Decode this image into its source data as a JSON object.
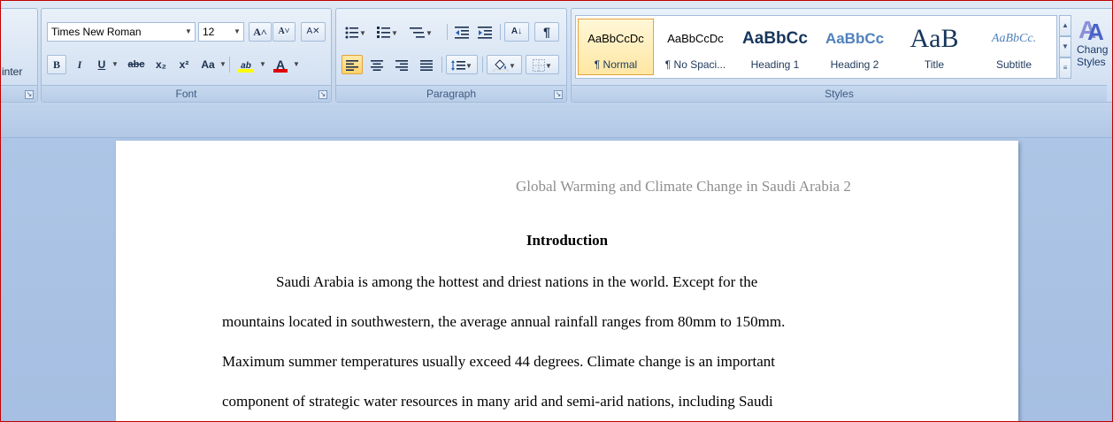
{
  "ribbon": {
    "clipboard": {
      "format_painter_label": "inter"
    },
    "font": {
      "group_label": "Font",
      "font_name": "Times New Roman",
      "font_size": "12",
      "grow_font": "A˄",
      "shrink_font": "A˅",
      "clear_format": "A✕",
      "bold": "B",
      "italic": "I",
      "underline": "U",
      "strikethrough": "abc",
      "subscript": "x₂",
      "superscript": "x²",
      "change_case": "Aa",
      "highlight": "ab",
      "font_color": "A"
    },
    "paragraph": {
      "group_label": "Paragraph",
      "sort": "A↓",
      "show_marks": "¶"
    },
    "styles": {
      "group_label": "Styles",
      "items": [
        {
          "sample": "AaBbCcDc",
          "name": "¶ Normal"
        },
        {
          "sample": "AaBbCcDc",
          "name": "¶ No Spaci..."
        },
        {
          "sample": "AaBbCc",
          "name": "Heading 1"
        },
        {
          "sample": "AaBbCc",
          "name": "Heading 2"
        },
        {
          "sample": "AaB",
          "name": "Title"
        },
        {
          "sample": "AaBbCc.",
          "name": "Subtitle"
        }
      ],
      "change_styles_line1": "Chang",
      "change_styles_line2": "Styles"
    }
  },
  "document": {
    "header": "Global Warming and Climate Change in Saudi Arabia 2",
    "heading": "Introduction",
    "lines": [
      "Saudi Arabia is among the hottest and driest nations in the world. Except for the",
      "mountains located in southwestern, the average annual rainfall ranges from 80mm to 150mm.",
      "Maximum summer temperatures usually exceed 44 degrees. Climate change is an important",
      "component of strategic water resources in many arid and semi-arid nations, including Saudi"
    ]
  },
  "colors": {
    "frame_border": "#c00000",
    "ribbon_background": "#cbdbef",
    "selected_style": "#ffe7a3",
    "header_text": "#8e8e8e",
    "font_color_bar": "#e00000",
    "highlight_bar": "#ffff00"
  }
}
